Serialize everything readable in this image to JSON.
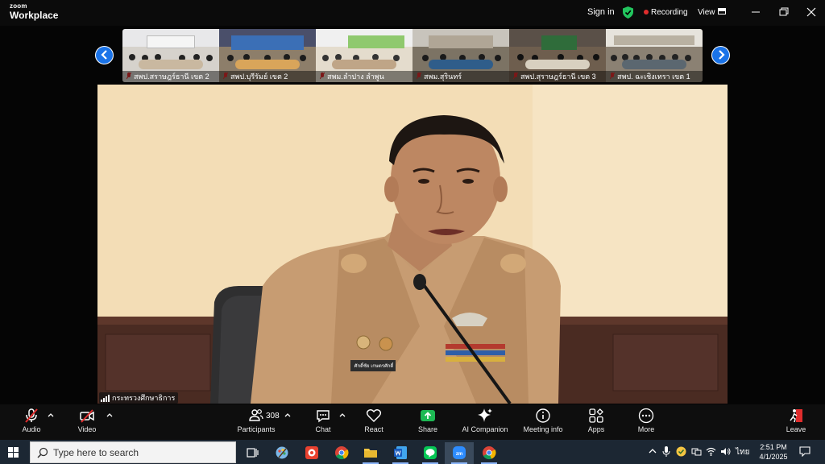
{
  "app": {
    "logo_small": "zoom",
    "logo_large": "Workplace",
    "sign_in": "Sign in",
    "recording": "Recording",
    "view": "View",
    "colors": {
      "accent": "#1a73e8",
      "record": "#e02d2d",
      "shield": "#22c55e"
    }
  },
  "gallery": {
    "tiles": [
      {
        "name": "สพป.สราษฎร์ธานี เขต 2",
        "icon": "mic-muted-icon"
      },
      {
        "name": "สพป.บุรีรัมย์ เขต 2",
        "icon": "mic-muted-icon"
      },
      {
        "name": "สพม.ลำปาง ลำพูน",
        "icon": "mic-muted-icon"
      },
      {
        "name": "สพม.สุรินทร์",
        "icon": "mic-muted-icon"
      },
      {
        "name": "สพป.สุราษฎร์ธานี เขต 3",
        "icon": "mic-muted-icon"
      },
      {
        "name": "สพป. ฉะเชิงเทรา เขต 1",
        "icon": "mic-muted-icon"
      }
    ],
    "prev_icon": "chevron-left-icon",
    "next_icon": "chevron-right-icon"
  },
  "main_video": {
    "speaker_name": "กระทรวงศึกษาธิการ",
    "name_plate": "ศักดิ์ชัย เกษตรศักดิ์"
  },
  "toolbar": {
    "audio": "Audio",
    "video": "Video",
    "participants": "Participants",
    "participant_count": "308",
    "chat": "Chat",
    "react": "React",
    "share": "Share",
    "ai_companion": "AI Companion",
    "meeting_info": "Meeting info",
    "apps": "Apps",
    "more": "More",
    "leave": "Leave"
  },
  "taskbar": {
    "search_placeholder": "Type here to search",
    "language": "ไทย",
    "time": "2:51 PM",
    "date": "4/1/2025",
    "apps": [
      "task-view-icon",
      "paint-icon",
      "app-red-icon",
      "chrome-icon",
      "file-explorer-icon",
      "word-icon",
      "line-icon",
      "zoom-icon",
      "chrome-icon"
    ]
  }
}
